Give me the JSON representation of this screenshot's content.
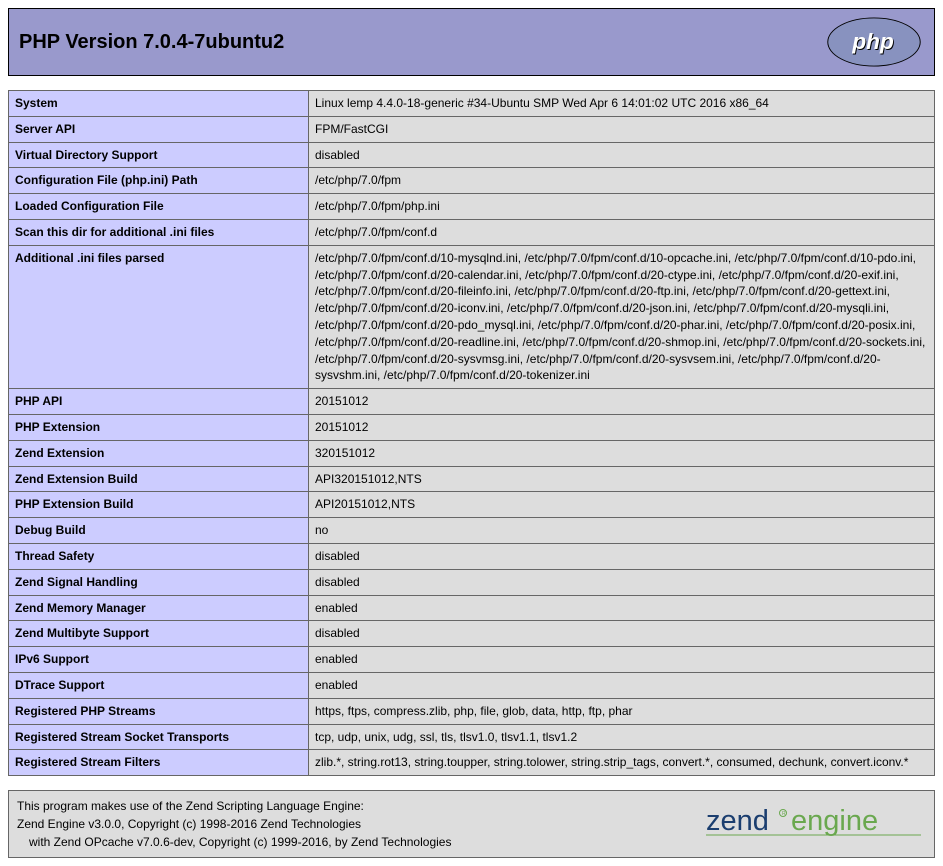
{
  "header": {
    "title": "PHP Version 7.0.4-7ubuntu2"
  },
  "rows": [
    {
      "key": "System",
      "val": "Linux lemp 4.4.0-18-generic #34-Ubuntu SMP Wed Apr 6 14:01:02 UTC 2016 x86_64"
    },
    {
      "key": "Server API",
      "val": "FPM/FastCGI"
    },
    {
      "key": "Virtual Directory Support",
      "val": "disabled"
    },
    {
      "key": "Configuration File (php.ini) Path",
      "val": "/etc/php/7.0/fpm"
    },
    {
      "key": "Loaded Configuration File",
      "val": "/etc/php/7.0/fpm/php.ini"
    },
    {
      "key": "Scan this dir for additional .ini files",
      "val": "/etc/php/7.0/fpm/conf.d"
    },
    {
      "key": "Additional .ini files parsed",
      "val": "/etc/php/7.0/fpm/conf.d/10-mysqlnd.ini, /etc/php/7.0/fpm/conf.d/10-opcache.ini, /etc/php/7.0/fpm/conf.d/10-pdo.ini, /etc/php/7.0/fpm/conf.d/20-calendar.ini, /etc/php/7.0/fpm/conf.d/20-ctype.ini, /etc/php/7.0/fpm/conf.d/20-exif.ini, /etc/php/7.0/fpm/conf.d/20-fileinfo.ini, /etc/php/7.0/fpm/conf.d/20-ftp.ini, /etc/php/7.0/fpm/conf.d/20-gettext.ini, /etc/php/7.0/fpm/conf.d/20-iconv.ini, /etc/php/7.0/fpm/conf.d/20-json.ini, /etc/php/7.0/fpm/conf.d/20-mysqli.ini, /etc/php/7.0/fpm/conf.d/20-pdo_mysql.ini, /etc/php/7.0/fpm/conf.d/20-phar.ini, /etc/php/7.0/fpm/conf.d/20-posix.ini, /etc/php/7.0/fpm/conf.d/20-readline.ini, /etc/php/7.0/fpm/conf.d/20-shmop.ini, /etc/php/7.0/fpm/conf.d/20-sockets.ini, /etc/php/7.0/fpm/conf.d/20-sysvmsg.ini, /etc/php/7.0/fpm/conf.d/20-sysvsem.ini, /etc/php/7.0/fpm/conf.d/20-sysvshm.ini, /etc/php/7.0/fpm/conf.d/20-tokenizer.ini"
    },
    {
      "key": "PHP API",
      "val": "20151012"
    },
    {
      "key": "PHP Extension",
      "val": "20151012"
    },
    {
      "key": "Zend Extension",
      "val": "320151012"
    },
    {
      "key": "Zend Extension Build",
      "val": "API320151012,NTS"
    },
    {
      "key": "PHP Extension Build",
      "val": "API20151012,NTS"
    },
    {
      "key": "Debug Build",
      "val": "no"
    },
    {
      "key": "Thread Safety",
      "val": "disabled"
    },
    {
      "key": "Zend Signal Handling",
      "val": "disabled"
    },
    {
      "key": "Zend Memory Manager",
      "val": "enabled"
    },
    {
      "key": "Zend Multibyte Support",
      "val": "disabled"
    },
    {
      "key": "IPv6 Support",
      "val": "enabled"
    },
    {
      "key": "DTrace Support",
      "val": "enabled"
    },
    {
      "key": "Registered PHP Streams",
      "val": "https, ftps, compress.zlib, php, file, glob, data, http, ftp, phar"
    },
    {
      "key": "Registered Stream Socket Transports",
      "val": "tcp, udp, unix, udg, ssl, tls, tlsv1.0, tlsv1.1, tlsv1.2"
    },
    {
      "key": "Registered Stream Filters",
      "val": "zlib.*, string.rot13, string.toupper, string.tolower, string.strip_tags, convert.*, consumed, dechunk, convert.iconv.*"
    }
  ],
  "zend": {
    "line1": "This program makes use of the Zend Scripting Language Engine:",
    "line2": "Zend Engine v3.0.0, Copyright (c) 1998-2016 Zend Technologies",
    "line3": "with Zend OPcache v7.0.6-dev, Copyright (c) 1999-2016, by Zend Technologies"
  }
}
